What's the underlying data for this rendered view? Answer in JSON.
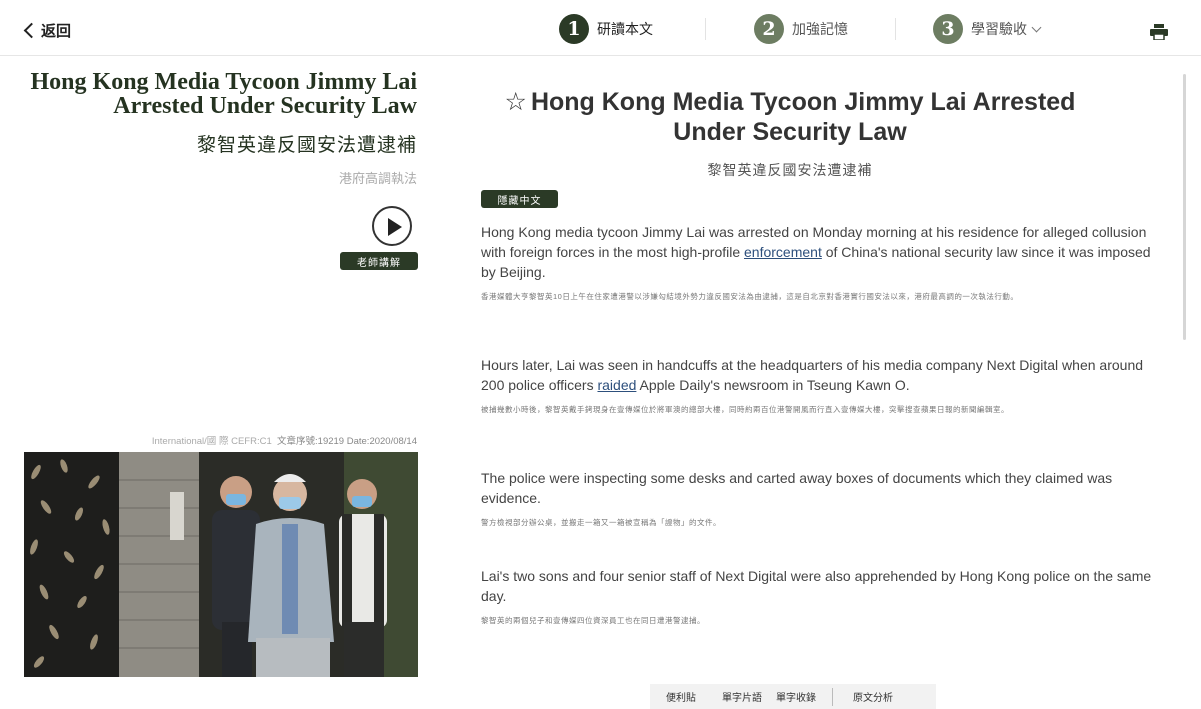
{
  "nav": {
    "back_label": "返回",
    "steps": [
      {
        "number": "1",
        "label": "研讀本文"
      },
      {
        "number": "2",
        "label": "加強記憶"
      },
      {
        "number": "3",
        "label": "學習驗收"
      }
    ],
    "print_icon": "printer-icon"
  },
  "left": {
    "title_en": "Hong Kong Media Tycoon Jimmy Lai Arrested Under Security Law",
    "title_zh": "黎智英違反國安法遭逮補",
    "subtitle": "港府高調執法",
    "teacher_button": "老師講解",
    "meta_category": "International/國 際",
    "meta_cefr": "CEFR:C1",
    "meta_serial": "文章序號:19219",
    "meta_date": "Date:2020/08/14"
  },
  "article": {
    "title": "Hong Kong Media Tycoon Jimmy Lai Arrested Under Security Law",
    "title_zh": "黎智英違反國安法遭逮補",
    "hide_chinese_button": "隱藏中文",
    "p1": {
      "en_a": "Hong Kong media tycoon Jimmy Lai was arrested on Monday morning at his residence for alleged collusion with foreign forces in the most high-profile ",
      "kw": "enforcement",
      "en_b": " of China's national security law since it was imposed by Beijing.",
      "zh": "香港媒體大亨黎智英10日上午在住家遭港警以涉嫌勾結境外勢力違反國安法為由逮捕，這是自北京對香港實行國安法以來，港府最高調的一次執法行動。"
    },
    "p2": {
      "en_a": "Hours later, Lai was seen in handcuffs at the headquarters of his media company Next Digital when around 200 police officers ",
      "kw": "raided",
      "en_b": " Apple Daily's newsroom in Tseung Kawn O.",
      "zh": "被捕幾數小時後，黎智英戴手銬現身在壹傳媒位於將軍澳的總部大樓，同時約兩百位港警開風而行直入壹傳媒大樓，突擊搜查蘋果日報的新聞編輯室。"
    },
    "p3": {
      "en": "The police were inspecting some desks and carted away boxes of documents which they claimed was evidence.",
      "zh": "警方檢視部分辦公桌，並搬走一箱又一箱被宣稱為「證物」的文件。"
    },
    "p4": {
      "en": "Lai's two sons and four senior staff of Next Digital were also apprehended by Hong Kong police on the same day.",
      "zh": "黎智英的兩個兒子和壹傳媒四位資深員工也在同日遭港警逮捕。"
    }
  },
  "toolbar": {
    "sticky_notes": "便利貼",
    "phrases": "單字片語",
    "word_collection": "單字收錄",
    "text_analysis": "原文分析"
  }
}
